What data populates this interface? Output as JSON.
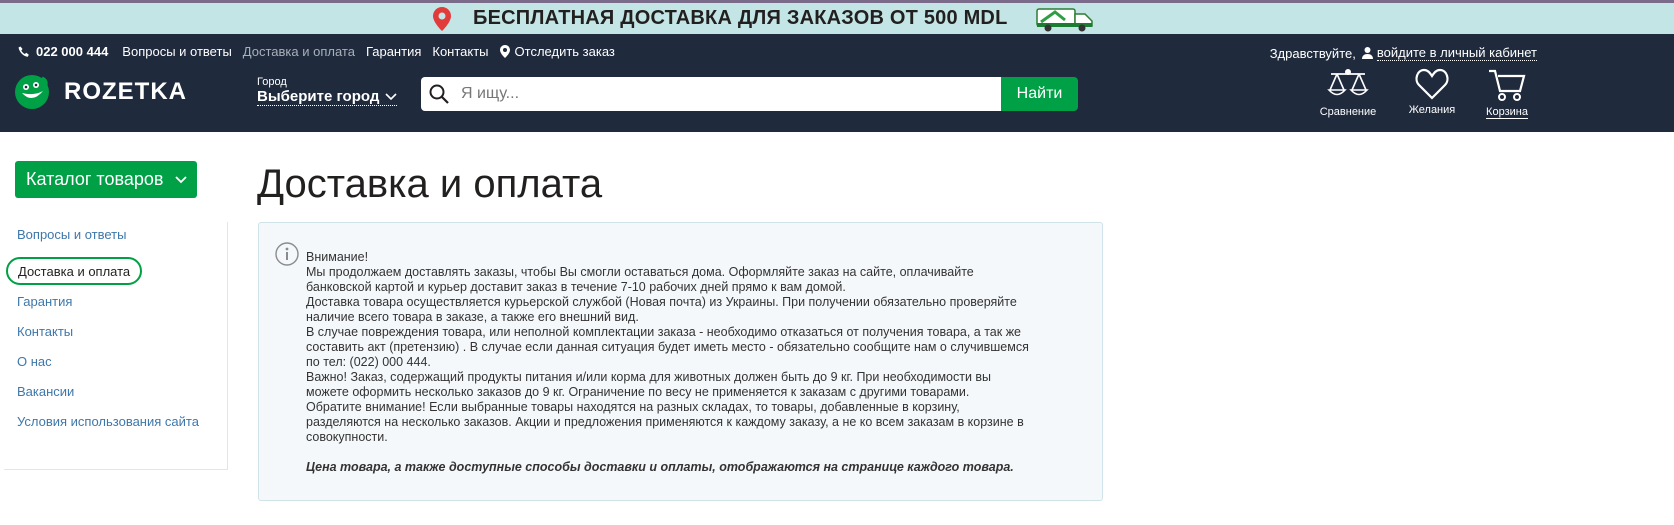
{
  "promo": {
    "text": "БЕСПЛАТНАЯ ДОСТАВКА ДЛЯ ЗАКАЗОВ ОТ 500 MDL"
  },
  "header": {
    "phone": "022 000 444",
    "links": [
      "Вопросы и ответы",
      "Доставка и оплата",
      "Гарантия",
      "Контакты"
    ],
    "track_label": "Отследить заказ",
    "greeting": "Здравствуйте,",
    "cabinet_link": "войдите в личный кабинет",
    "logo_text": "ROZETKA",
    "city_label": "Город",
    "city_value": "Выберите город",
    "search_placeholder": "Я ищу...",
    "search_button": "Найти",
    "actions": {
      "compare": "Сравнение",
      "wishlist": "Желания",
      "cart": "Корзина"
    }
  },
  "sidebar": {
    "catalog_button": "Каталог товаров",
    "items": [
      "Вопросы и ответы",
      "Доставка и оплата",
      "Гарантия",
      "Контакты",
      "О нас",
      "Вакансии",
      "Условия использования сайта"
    ],
    "active_index": 1
  },
  "main": {
    "title": "Доставка и оплата",
    "notice": {
      "lines": [
        "Внимание!",
        "Мы продолжаем доставлять заказы, чтобы Вы смогли оставаться дома. Оформляйте заказ на сайте, оплачивайте",
        "банковской картой и курьер доставит заказ в течение 7-10 рабочих дней прямо к вам домой.",
        "Доставка товара осуществляется курьерской службой (Новая почта) из Украины. При получении обязательно проверяйте",
        "наличие всего товара в заказе, а также его внешний вид.",
        "В случае повреждения товара, или неполной комплектации заказа - необходимо отказаться от получения товара, а так же",
        "составить акт (претензию) . В случае если данная ситуация будет иметь место - обязательно сообщите нам о случившемся",
        "по тел: (022) 000 444.",
        "Важно! Заказ, содержащий продукты питания и/или корма для животных должен быть до 9 кг. При необходимости вы",
        "можете оформить несколько заказов до 9 кг. Ограничение по весу не применяется к заказам с другими товарами.",
        "Обратите внимание! Если выбранные товары находятся на разных складах, то товары, добавленные в корзину,",
        "разделяются на несколько заказов. Акции и предложения применяются к каждому заказу, а не ко всем заказам в корзине в",
        "совокупности."
      ],
      "emphasis": "Цена товара, а также доступные способы доставки и оплаты, отображаются на странице каждого товара."
    }
  },
  "colors": {
    "header_bg": "#1f2a3c",
    "promo_bg": "#c4e5e6",
    "accent_green": "#00a046",
    "link_blue": "#3e77aa"
  }
}
